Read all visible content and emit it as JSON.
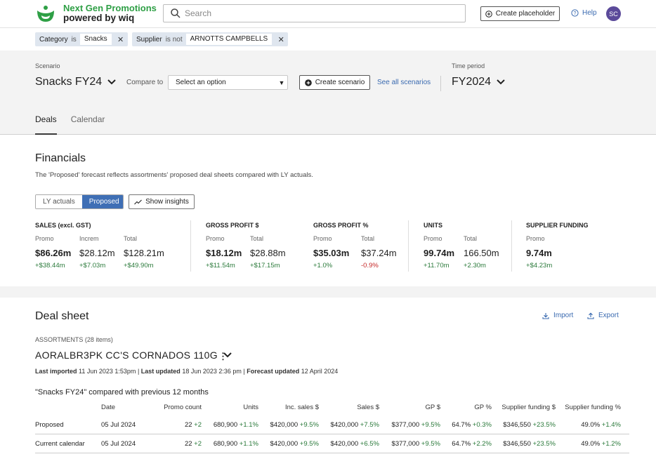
{
  "header": {
    "brand_title": "Next Gen Promotions",
    "brand_sub": "powered by wiq",
    "search_placeholder": "Search",
    "create_placeholder_label": "Create placeholder",
    "help_label": "Help",
    "avatar_initials": "SC",
    "brand_color": "#2e9f45"
  },
  "filters": [
    {
      "key": "Category",
      "op": "is",
      "value": "Snacks"
    },
    {
      "key": "Supplier",
      "op": "is not",
      "value": "ARNOTTS CAMPBELLS"
    }
  ],
  "scenario": {
    "label": "Scenario",
    "name": "Snacks FY24",
    "compare_label": "Compare to",
    "compare_placeholder": "Select an option",
    "create_label": "Create scenario",
    "see_all_label": "See all scenarios",
    "time_label": "Time period",
    "time_value": "FY2024"
  },
  "tabs": [
    {
      "label": "Deals",
      "active": true
    },
    {
      "label": "Calendar",
      "active": false
    }
  ],
  "financials": {
    "title": "Financials",
    "description": "The 'Proposed' forecast reflects assortments' proposed deal sheets compared with LY actuals.",
    "toggle_options": [
      "LY actuals",
      "Proposed"
    ],
    "toggle_selected": "Proposed",
    "insights_label": "Show insights",
    "metrics": [
      {
        "title": "SALES (excl. GST)",
        "cols": [
          {
            "sub": "Promo",
            "value": "$86.26m",
            "change": "+$38.44m",
            "dir": "pos"
          },
          {
            "sub": "Increm",
            "value": "$28.12m",
            "change": "+$7.03m",
            "dir": "pos"
          },
          {
            "sub": "Total",
            "value": "$128.21m",
            "change": "+$49.90m",
            "dir": "pos"
          }
        ]
      },
      {
        "title": "GROSS PROFIT $",
        "cols": [
          {
            "sub": "Promo",
            "value": "$18.12m",
            "change": "+$11.54m",
            "dir": "pos"
          },
          {
            "sub": "Total",
            "value": "$28.88m",
            "change": "+$17.15m",
            "dir": "pos"
          }
        ]
      },
      {
        "title": "GROSS PROFIT %",
        "cols": [
          {
            "sub": "Promo",
            "value": "$35.03m",
            "change": "+1.0%",
            "dir": "pos"
          },
          {
            "sub": "Total",
            "value": "$37.24m",
            "change": "-0.9%",
            "dir": "neg"
          }
        ]
      },
      {
        "title": "UNITS",
        "cols": [
          {
            "sub": "Promo",
            "value": "99.74m",
            "change": "+11.70m",
            "dir": "pos"
          },
          {
            "sub": "Total",
            "value": "166.50m",
            "change": "+2.30m",
            "dir": "pos"
          }
        ]
      },
      {
        "title": "SUPPLIER FUNDING",
        "cols": [
          {
            "sub": "Promo",
            "value": "9.74m",
            "change": "+$4.23m",
            "dir": "pos"
          }
        ]
      }
    ],
    "positive_color": "#2b7a3b",
    "negative_color": "#c62828"
  },
  "deal_sheet": {
    "title": "Deal sheet",
    "import_label": "Import",
    "export_label": "Export",
    "assortments_label": "ASSORTMENTS (28 items)",
    "assortment_code": "AORALBR3PK",
    "assortment_name": "CC'S CORNADOS 110G",
    "last_imported_label": "Last imported",
    "last_imported_value": "11 Jun 2023 1:53pm",
    "last_updated_label": "Last updated",
    "last_updated_value": "18 Jun 2023 2:36 pm",
    "forecast_updated_label": "Forecast updated",
    "forecast_updated_value": "12 April 2024",
    "compare_title": "\"Snacks FY24\" compared with previous 12 months",
    "columns": [
      "Date",
      "Promo count",
      "Units",
      "Inc. sales $",
      "Sales $",
      "GP $",
      "GP %",
      "Supplier funding $",
      "Supplier funding %"
    ],
    "rows": [
      {
        "label": "Proposed",
        "date": "05 Jul 2024",
        "cells": [
          {
            "v": "22",
            "d": "+2"
          },
          {
            "v": "680,900",
            "d": "+1.1%"
          },
          {
            "v": "$420,000",
            "d": "+9.5%"
          },
          {
            "v": "$420,000",
            "d": "+7.5%"
          },
          {
            "v": "$377,000",
            "d": "+9.5%"
          },
          {
            "v": "64.7%",
            "d": "+0.3%"
          },
          {
            "v": "$346,550",
            "d": "+23.5%"
          },
          {
            "v": "49.0%",
            "d": "+1.4%"
          }
        ]
      },
      {
        "label": "Current calendar",
        "date": "05 Jul 2024",
        "cells": [
          {
            "v": "22",
            "d": "+2"
          },
          {
            "v": "680,900",
            "d": "+1.1%"
          },
          {
            "v": "$420,000",
            "d": "+9.5%"
          },
          {
            "v": "$420,000",
            "d": "+6.5%"
          },
          {
            "v": "$377,000",
            "d": "+9.5%"
          },
          {
            "v": "64.7%",
            "d": "+2.2%"
          },
          {
            "v": "$346,550",
            "d": "+23.5%"
          },
          {
            "v": "49.0%",
            "d": "+1.2%"
          }
        ]
      }
    ]
  }
}
